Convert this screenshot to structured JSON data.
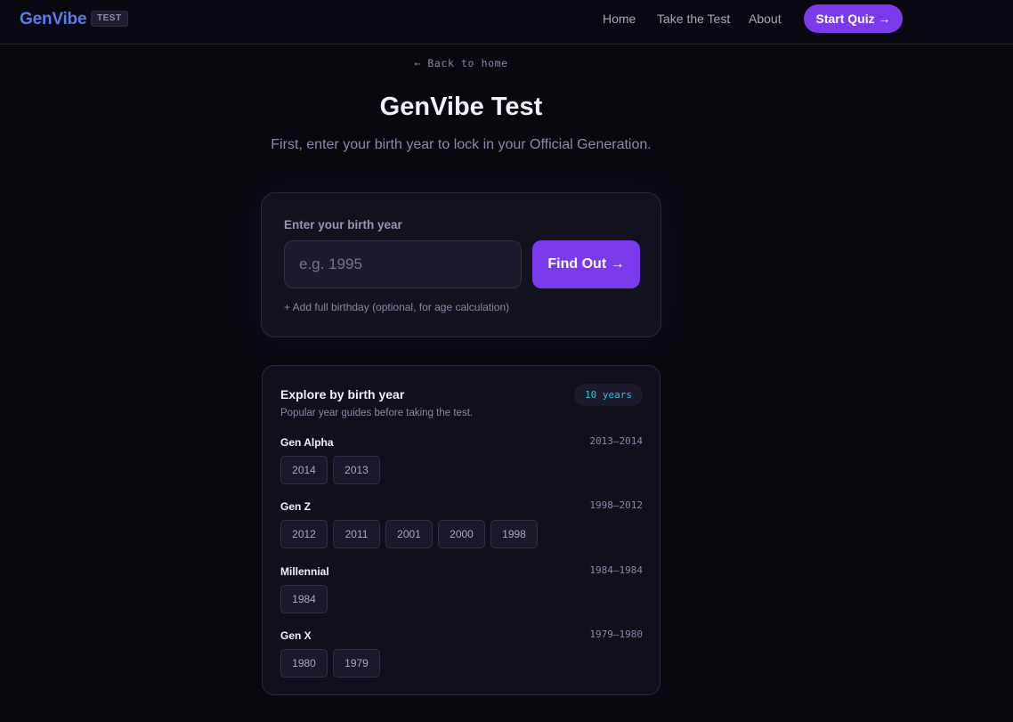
{
  "nav": {
    "brand": "GenVibe",
    "badge": "TEST",
    "links": [
      "Home",
      "Take the Test",
      "About"
    ],
    "cta": "Start Quiz →",
    "colors": {
      "brand": "#5b7cf0",
      "accent": "#7c3aed"
    }
  },
  "hero": {
    "back": "← Back to home",
    "title": "GenVibe Test",
    "subtitle": "First, enter your birth year to lock in your Official Generation."
  },
  "form": {
    "label": "Enter your birth year",
    "placeholder": "e.g. 1995",
    "button": "Find Out →",
    "add_birthday": "+ Add full birthday (optional, for age calculation)"
  },
  "explore": {
    "title": "Explore by birth year",
    "subtitle": "Popular year guides before taking the test.",
    "badge": "10 years",
    "badge_color": "#22c5d8",
    "generations": [
      {
        "name": "Gen Alpha",
        "range": "2013–2014",
        "years": [
          "2014",
          "2013"
        ]
      },
      {
        "name": "Gen Z",
        "range": "1998–2012",
        "years": [
          "2012",
          "2011",
          "2001",
          "2000",
          "1998"
        ]
      },
      {
        "name": "Millennial",
        "range": "1984–1984",
        "years": [
          "1984"
        ]
      },
      {
        "name": "Gen X",
        "range": "1979–1980",
        "years": [
          "1980",
          "1979"
        ]
      }
    ]
  }
}
